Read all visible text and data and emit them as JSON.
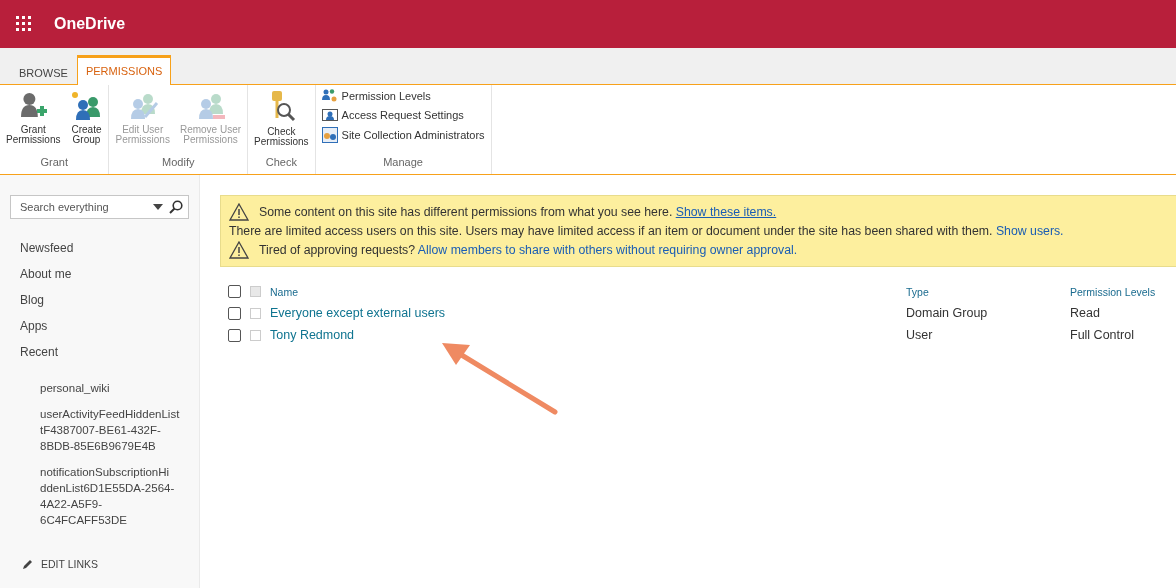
{
  "header": {
    "app_name": "OneDrive"
  },
  "tabs": [
    {
      "label": "BROWSE",
      "selected": false
    },
    {
      "label": "PERMISSIONS",
      "selected": true
    }
  ],
  "ribbon": [
    {
      "label": "Grant",
      "kind": "large",
      "buttons": [
        {
          "label": "Grant\nPermissions",
          "disabled": false
        },
        {
          "label": "Create\nGroup",
          "disabled": false
        }
      ]
    },
    {
      "label": "Modify",
      "kind": "large",
      "buttons": [
        {
          "label": "Edit User\nPermissions",
          "disabled": true
        },
        {
          "label": "Remove User\nPermissions",
          "disabled": true
        }
      ]
    },
    {
      "label": "Check",
      "kind": "large",
      "buttons": [
        {
          "label": "Check\nPermissions",
          "disabled": false
        }
      ]
    },
    {
      "label": "Manage",
      "kind": "small",
      "buttons": [
        {
          "label": "Permission Levels",
          "disabled": false
        },
        {
          "label": "Access Request Settings",
          "disabled": false
        },
        {
          "label": "Site Collection Administrators",
          "disabled": false
        }
      ]
    }
  ],
  "sidebar": {
    "search": {
      "placeholder": "Search everything"
    },
    "items": [
      {
        "label": "Newsfeed"
      },
      {
        "label": "About me"
      },
      {
        "label": "Blog"
      },
      {
        "label": "Apps"
      },
      {
        "label": "Recent",
        "children": [
          {
            "label": "personal_wiki"
          },
          {
            "label": "userActivityFeedHiddenList\ntF4387007-BE61-432F-\n8BDB-85E6B9679E4B"
          },
          {
            "label": "notificationSubscriptionHi\nddenList6D1E55DA-2564-\n4A22-A5F9-\n6C4FCAFF53DE"
          }
        ]
      }
    ],
    "edit_links": "EDIT LINKS"
  },
  "notices": [
    {
      "kind": "warning",
      "text": "Some content on this site has different permissions from what you see here.",
      "link": "Show these items.",
      "underlined": true
    },
    {
      "kind": "plain",
      "text": "There are limited access users on this site. Users may have limited access if an item or document under the site has been shared with them.",
      "link": "Show users.",
      "underlined": false
    },
    {
      "kind": "warning",
      "text": "Tired of approving requests?",
      "link": "Allow members to share with others without requiring owner approval.",
      "underlined": false
    }
  ],
  "table": {
    "select_all_checked": false,
    "header_box_checked": false,
    "columns": [
      {
        "label": "Name"
      },
      {
        "label": "Type"
      },
      {
        "label": "Permission Levels"
      }
    ],
    "rows": [
      {
        "name": "Everyone except external users",
        "type": "Domain Group",
        "permission_levels": "Read",
        "checked": false
      },
      {
        "name": "Tony Redmond",
        "type": "User",
        "permission_levels": "Full Control",
        "checked": false
      }
    ]
  }
}
